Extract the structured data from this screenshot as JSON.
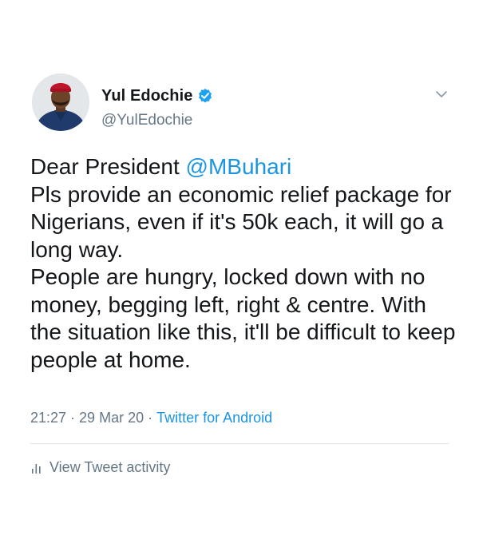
{
  "tweet": {
    "author": {
      "display_name": "Yul Edochie",
      "handle": "@YulEdochie",
      "verified": true
    },
    "text": {
      "intro": "Dear President ",
      "mention": "@MBuhari",
      "body": "\nPls provide an economic relief package for Nigerians, even if it's 50k each, it will go a long way.\nPeople are hungry, locked down with no money, begging left, right & centre. With the situation like this, it'll be difficult to keep people at home."
    },
    "meta": {
      "time": "21:27",
      "separator_1": "·",
      "date": "29 Mar 20",
      "separator_2": "·",
      "source": "Twitter for Android"
    },
    "activity_label": "View Tweet activity"
  },
  "colors": {
    "accent": "#1b95e0",
    "secondary_text": "#657786",
    "primary_text": "#14171a",
    "divider": "#e1e8ed"
  },
  "icons": {
    "verified": "verified-badge-icon",
    "menu": "chevron-down-icon",
    "activity": "bar-chart-icon"
  }
}
